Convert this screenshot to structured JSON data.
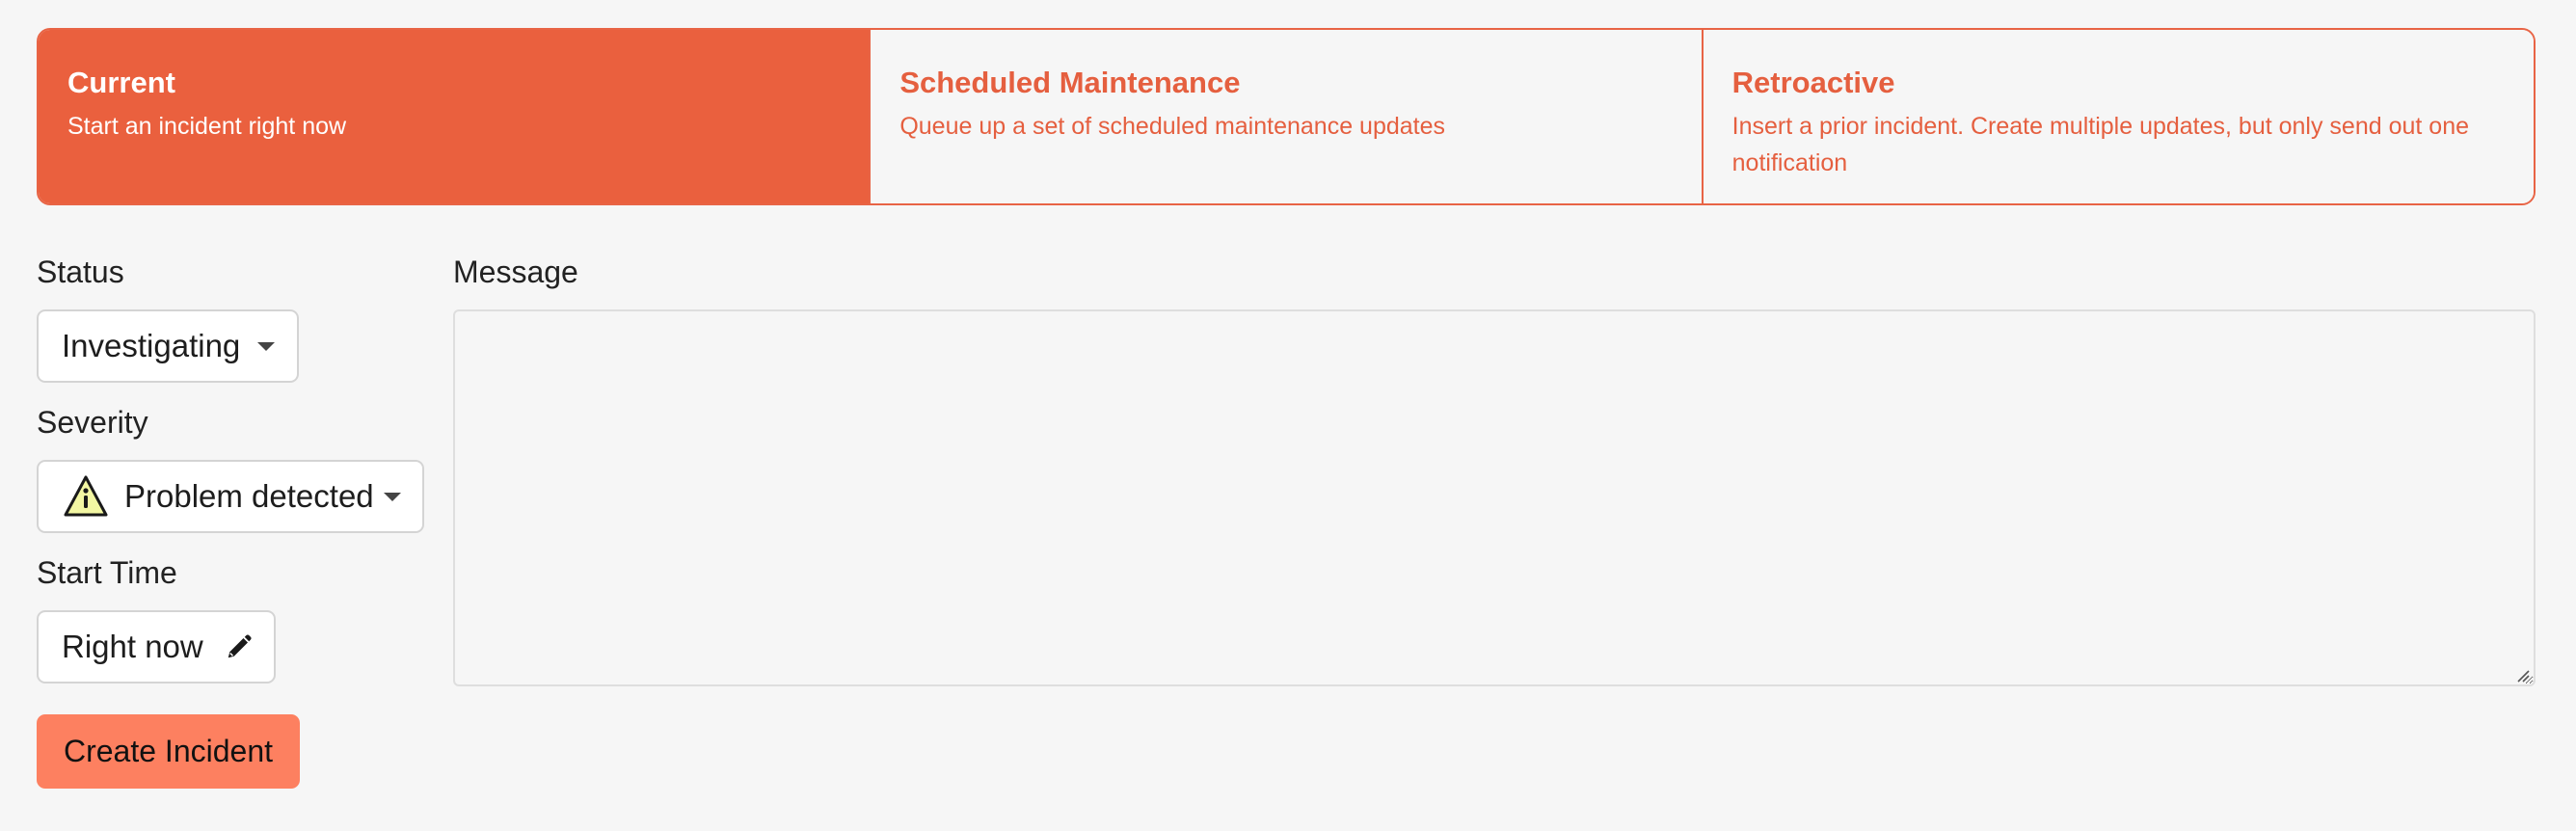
{
  "incident_types": [
    {
      "title": "Current",
      "description": "Start an incident right now",
      "active": true
    },
    {
      "title": "Scheduled Maintenance",
      "description": "Queue up a set of scheduled maintenance updates",
      "active": false
    },
    {
      "title": "Retroactive",
      "description": "Insert a prior incident. Create multiple updates, but only send out one notification",
      "active": false
    }
  ],
  "form": {
    "status_label": "Status",
    "status_value": "Investigating",
    "severity_label": "Severity",
    "severity_value": "Problem detected",
    "severity_icon": "warning-triangle-icon",
    "start_time_label": "Start Time",
    "start_time_value": "Right now",
    "start_time_icon": "pencil-icon",
    "message_label": "Message",
    "message_value": "",
    "submit_label": "Create Incident"
  },
  "colors": {
    "accent": "#ea603e",
    "accent_text": "#e55f3f",
    "button": "#fd8060",
    "warning_fill": "#f3f7a3",
    "background": "#f6f6f6"
  }
}
